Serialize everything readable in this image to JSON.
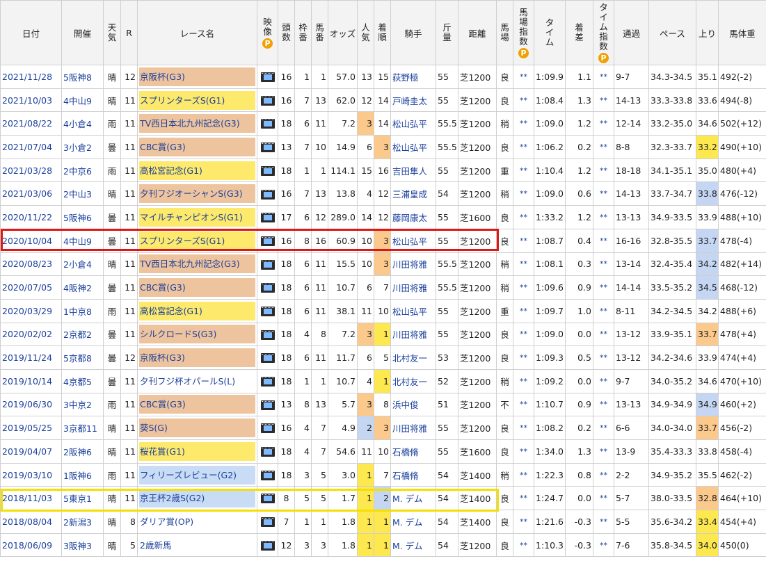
{
  "headers": {
    "date": "日付",
    "venue": "開催",
    "weather": "天気",
    "r": "R",
    "race": "レース名",
    "video": "映像",
    "p": "P",
    "heads": "頭数",
    "waku": "枠番",
    "uma": "馬番",
    "odds": "オッズ",
    "ninki": "人気",
    "chakujun": "着順",
    "jockey": "騎手",
    "kinryo": "斤量",
    "distance": "距離",
    "baba": "馬場",
    "babashisu": "馬場指数",
    "time": "タイム",
    "chakusa": "着差",
    "timeshisu": "タイム指数",
    "tsuka": "通過",
    "pace": "ペース",
    "agari": "上り",
    "bataiju": "馬体重"
  },
  "rows": [
    {
      "date": "2021/11/28",
      "venue": "5阪神8",
      "weather": "晴",
      "r": "12",
      "race": "京阪杯(G3)",
      "grade": "g3",
      "heads": "16",
      "waku": "1",
      "uma": "1",
      "odds": "57.0",
      "ninki": "13",
      "chaku": "15",
      "jockey": "荻野極",
      "kinryo": "55",
      "dist": "芝1200",
      "baba": "良",
      "bs": "**",
      "time": "1:09.9",
      "diff": "1.1",
      "ts": "**",
      "pass": "9-7",
      "pace": "34.3-34.5",
      "agari": "35.1",
      "weight": "492(-2)",
      "nk": "",
      "ck": "",
      "ak": ""
    },
    {
      "date": "2021/10/03",
      "venue": "4中山9",
      "weather": "晴",
      "r": "11",
      "race": "スプリンターズS(G1)",
      "grade": "g1",
      "heads": "16",
      "waku": "7",
      "uma": "13",
      "odds": "62.0",
      "ninki": "12",
      "chaku": "14",
      "jockey": "戸崎圭太",
      "kinryo": "55",
      "dist": "芝1200",
      "baba": "良",
      "bs": "**",
      "time": "1:08.4",
      "diff": "1.3",
      "ts": "**",
      "pass": "14-13",
      "pace": "33.3-33.8",
      "agari": "33.6",
      "weight": "494(-8)",
      "nk": "",
      "ck": "",
      "ak": ""
    },
    {
      "date": "2021/08/22",
      "venue": "4小倉4",
      "weather": "雨",
      "r": "11",
      "race": "TV西日本北九州記念(G3)",
      "grade": "g3",
      "heads": "18",
      "waku": "6",
      "uma": "11",
      "odds": "7.2",
      "ninki": "3",
      "chaku": "14",
      "jockey": "松山弘平",
      "kinryo": "55.5",
      "dist": "芝1200",
      "baba": "稍",
      "bs": "**",
      "time": "1:09.0",
      "diff": "1.2",
      "ts": "**",
      "pass": "12-14",
      "pace": "33.2-35.0",
      "agari": "34.6",
      "weight": "502(+12)",
      "nk": "hl1",
      "ck": "",
      "ak": ""
    },
    {
      "date": "2021/07/04",
      "venue": "3小倉2",
      "weather": "曇",
      "r": "11",
      "race": "CBC賞(G3)",
      "grade": "g3",
      "heads": "13",
      "waku": "7",
      "uma": "10",
      "odds": "14.9",
      "ninki": "6",
      "chaku": "3",
      "jockey": "松山弘平",
      "kinryo": "55.5",
      "dist": "芝1200",
      "baba": "良",
      "bs": "**",
      "time": "1:06.2",
      "diff": "0.2",
      "ts": "**",
      "pass": "8-8",
      "pace": "32.3-33.7",
      "agari": "33.2",
      "weight": "490(+10)",
      "nk": "",
      "ck": "hl1",
      "ak": "up1"
    },
    {
      "date": "2021/03/28",
      "venue": "2中京6",
      "weather": "雨",
      "r": "11",
      "race": "高松宮記念(G1)",
      "grade": "g1",
      "heads": "18",
      "waku": "1",
      "uma": "1",
      "odds": "114.1",
      "ninki": "15",
      "chaku": "16",
      "jockey": "吉田隼人",
      "kinryo": "55",
      "dist": "芝1200",
      "baba": "重",
      "bs": "**",
      "time": "1:10.4",
      "diff": "1.2",
      "ts": "**",
      "pass": "18-18",
      "pace": "34.1-35.1",
      "agari": "35.0",
      "weight": "480(+4)",
      "nk": "",
      "ck": "",
      "ak": ""
    },
    {
      "date": "2021/03/06",
      "venue": "2中山3",
      "weather": "晴",
      "r": "11",
      "race": "夕刊フジオーシャンS(G3)",
      "grade": "g3",
      "heads": "16",
      "waku": "7",
      "uma": "13",
      "odds": "13.8",
      "ninki": "4",
      "chaku": "12",
      "jockey": "三浦皇成",
      "kinryo": "54",
      "dist": "芝1200",
      "baba": "稍",
      "bs": "**",
      "time": "1:09.0",
      "diff": "0.6",
      "ts": "**",
      "pass": "14-13",
      "pace": "33.7-34.7",
      "agari": "33.8",
      "weight": "476(-12)",
      "nk": "",
      "ck": "",
      "ak": "up3"
    },
    {
      "date": "2020/11/22",
      "venue": "5阪神6",
      "weather": "曇",
      "r": "11",
      "race": "マイルチャンピオンS(G1)",
      "grade": "g1",
      "heads": "17",
      "waku": "6",
      "uma": "12",
      "odds": "289.0",
      "ninki": "14",
      "chaku": "12",
      "jockey": "藤岡康太",
      "kinryo": "55",
      "dist": "芝1600",
      "baba": "良",
      "bs": "**",
      "time": "1:33.2",
      "diff": "1.2",
      "ts": "**",
      "pass": "13-13",
      "pace": "34.9-33.5",
      "agari": "33.9",
      "weight": "488(+10)",
      "nk": "",
      "ck": "",
      "ak": ""
    },
    {
      "date": "2020/10/04",
      "venue": "4中山9",
      "weather": "曇",
      "r": "11",
      "race": "スプリンターズS(G1)",
      "grade": "g1",
      "heads": "16",
      "waku": "8",
      "uma": "16",
      "odds": "60.9",
      "ninki": "10",
      "chaku": "3",
      "jockey": "松山弘平",
      "kinryo": "55",
      "dist": "芝1200",
      "baba": "良",
      "bs": "**",
      "time": "1:08.7",
      "diff": "0.4",
      "ts": "**",
      "pass": "16-16",
      "pace": "32.8-35.5",
      "agari": "33.7",
      "weight": "478(-4)",
      "nk": "",
      "ck": "hl1",
      "ak": "up3"
    },
    {
      "date": "2020/08/23",
      "venue": "2小倉4",
      "weather": "晴",
      "r": "11",
      "race": "TV西日本北九州記念(G3)",
      "grade": "g3",
      "heads": "18",
      "waku": "6",
      "uma": "11",
      "odds": "15.5",
      "ninki": "10",
      "chaku": "3",
      "jockey": "川田将雅",
      "kinryo": "55.5",
      "dist": "芝1200",
      "baba": "稍",
      "bs": "**",
      "time": "1:08.1",
      "diff": "0.3",
      "ts": "**",
      "pass": "13-14",
      "pace": "32.4-35.4",
      "agari": "34.2",
      "weight": "482(+14)",
      "nk": "",
      "ck": "hl1",
      "ak": "up3"
    },
    {
      "date": "2020/07/05",
      "venue": "4阪神2",
      "weather": "曇",
      "r": "11",
      "race": "CBC賞(G3)",
      "grade": "g3",
      "heads": "18",
      "waku": "6",
      "uma": "11",
      "odds": "10.7",
      "ninki": "6",
      "chaku": "7",
      "jockey": "川田将雅",
      "kinryo": "55.5",
      "dist": "芝1200",
      "baba": "稍",
      "bs": "**",
      "time": "1:09.6",
      "diff": "0.9",
      "ts": "**",
      "pass": "14-14",
      "pace": "33.5-35.2",
      "agari": "34.5",
      "weight": "468(-12)",
      "nk": "",
      "ck": "",
      "ak": "up3"
    },
    {
      "date": "2020/03/29",
      "venue": "1中京8",
      "weather": "雨",
      "r": "11",
      "race": "高松宮記念(G1)",
      "grade": "g1",
      "heads": "18",
      "waku": "6",
      "uma": "11",
      "odds": "38.1",
      "ninki": "11",
      "chaku": "10",
      "jockey": "松山弘平",
      "kinryo": "55",
      "dist": "芝1200",
      "baba": "重",
      "bs": "**",
      "time": "1:09.7",
      "diff": "1.0",
      "ts": "**",
      "pass": "8-11",
      "pace": "34.2-34.5",
      "agari": "34.2",
      "weight": "488(+6)",
      "nk": "",
      "ck": "",
      "ak": ""
    },
    {
      "date": "2020/02/02",
      "venue": "2京都2",
      "weather": "曇",
      "r": "11",
      "race": "シルクロードS(G3)",
      "grade": "g3",
      "heads": "18",
      "waku": "4",
      "uma": "8",
      "odds": "7.2",
      "ninki": "3",
      "chaku": "1",
      "jockey": "川田将雅",
      "kinryo": "55",
      "dist": "芝1200",
      "baba": "良",
      "bs": "**",
      "time": "1:09.0",
      "diff": "0.0",
      "ts": "**",
      "pass": "13-12",
      "pace": "33.9-35.1",
      "agari": "33.7",
      "weight": "478(+4)",
      "nk": "hl1",
      "ck": "hl3",
      "ak": "up2"
    },
    {
      "date": "2019/11/24",
      "venue": "5京都8",
      "weather": "曇",
      "r": "12",
      "race": "京阪杯(G3)",
      "grade": "g3",
      "heads": "18",
      "waku": "6",
      "uma": "11",
      "odds": "11.7",
      "ninki": "6",
      "chaku": "5",
      "jockey": "北村友一",
      "kinryo": "53",
      "dist": "芝1200",
      "baba": "良",
      "bs": "**",
      "time": "1:09.3",
      "diff": "0.5",
      "ts": "**",
      "pass": "13-12",
      "pace": "34.2-34.6",
      "agari": "33.9",
      "weight": "474(+4)",
      "nk": "",
      "ck": "",
      "ak": ""
    },
    {
      "date": "2019/10/14",
      "venue": "4京都5",
      "weather": "曇",
      "r": "11",
      "race": "夕刊フジ杯オパールS(L)",
      "grade": "gn",
      "heads": "18",
      "waku": "1",
      "uma": "1",
      "odds": "10.7",
      "ninki": "4",
      "chaku": "1",
      "jockey": "北村友一",
      "kinryo": "52",
      "dist": "芝1200",
      "baba": "稍",
      "bs": "**",
      "time": "1:09.2",
      "diff": "0.0",
      "ts": "**",
      "pass": "9-7",
      "pace": "34.0-35.2",
      "agari": "34.6",
      "weight": "470(+10)",
      "nk": "",
      "ck": "hl3",
      "ak": ""
    },
    {
      "date": "2019/06/30",
      "venue": "3中京2",
      "weather": "雨",
      "r": "11",
      "race": "CBC賞(G3)",
      "grade": "g3",
      "heads": "13",
      "waku": "8",
      "uma": "13",
      "odds": "5.7",
      "ninki": "3",
      "chaku": "8",
      "jockey": "浜中俊",
      "kinryo": "51",
      "dist": "芝1200",
      "baba": "不",
      "bs": "**",
      "time": "1:10.7",
      "diff": "0.9",
      "ts": "**",
      "pass": "13-13",
      "pace": "34.9-34.9",
      "agari": "34.9",
      "weight": "460(+2)",
      "nk": "hl1",
      "ck": "",
      "ak": "up3"
    },
    {
      "date": "2019/05/25",
      "venue": "3京都11",
      "weather": "晴",
      "r": "11",
      "race": "葵S(G)",
      "grade": "g3",
      "heads": "16",
      "waku": "4",
      "uma": "7",
      "odds": "4.9",
      "ninki": "2",
      "chaku": "3",
      "jockey": "川田将雅",
      "kinryo": "55",
      "dist": "芝1200",
      "baba": "良",
      "bs": "**",
      "time": "1:08.2",
      "diff": "0.2",
      "ts": "**",
      "pass": "6-6",
      "pace": "34.0-34.0",
      "agari": "33.7",
      "weight": "456(-2)",
      "nk": "hl2",
      "ck": "hl1",
      "ak": "up2"
    },
    {
      "date": "2019/04/07",
      "venue": "2阪神6",
      "weather": "晴",
      "r": "11",
      "race": "桜花賞(G1)",
      "grade": "g1",
      "heads": "18",
      "waku": "4",
      "uma": "7",
      "odds": "54.6",
      "ninki": "11",
      "chaku": "10",
      "jockey": "石橋脩",
      "kinryo": "55",
      "dist": "芝1600",
      "baba": "良",
      "bs": "**",
      "time": "1:34.0",
      "diff": "1.3",
      "ts": "**",
      "pass": "13-9",
      "pace": "35.4-33.3",
      "agari": "33.8",
      "weight": "458(-4)",
      "nk": "",
      "ck": "",
      "ak": ""
    },
    {
      "date": "2019/03/10",
      "venue": "1阪神6",
      "weather": "雨",
      "r": "11",
      "race": "フィリーズレビュー(G2)",
      "grade": "g2",
      "heads": "18",
      "waku": "3",
      "uma": "5",
      "odds": "3.0",
      "ninki": "1",
      "chaku": "7",
      "jockey": "石橋脩",
      "kinryo": "54",
      "dist": "芝1400",
      "baba": "稍",
      "bs": "**",
      "time": "1:22.3",
      "diff": "0.8",
      "ts": "**",
      "pass": "2-2",
      "pace": "34.9-35.2",
      "agari": "35.5",
      "weight": "462(-2)",
      "nk": "hl3",
      "ck": "",
      "ak": ""
    },
    {
      "date": "2018/11/03",
      "venue": "5東京1",
      "weather": "晴",
      "r": "11",
      "race": "京王杯2歳S(G2)",
      "grade": "g2",
      "heads": "8",
      "waku": "5",
      "uma": "5",
      "odds": "1.7",
      "ninki": "1",
      "chaku": "2",
      "jockey": "M. デム",
      "kinryo": "54",
      "dist": "芝1400",
      "baba": "良",
      "bs": "**",
      "time": "1:24.7",
      "diff": "0.0",
      "ts": "**",
      "pass": "5-7",
      "pace": "38.0-33.5",
      "agari": "32.8",
      "weight": "464(+10)",
      "nk": "hl3",
      "ck": "hl2",
      "ak": "up2"
    },
    {
      "date": "2018/08/04",
      "venue": "2新潟3",
      "weather": "晴",
      "r": "8",
      "race": "ダリア賞(OP)",
      "grade": "gn",
      "heads": "7",
      "waku": "1",
      "uma": "1",
      "odds": "1.8",
      "ninki": "1",
      "chaku": "1",
      "jockey": "M. デム",
      "kinryo": "54",
      "dist": "芝1400",
      "baba": "良",
      "bs": "**",
      "time": "1:21.6",
      "diff": "-0.3",
      "ts": "**",
      "pass": "5-5",
      "pace": "35.6-34.2",
      "agari": "33.4",
      "weight": "454(+4)",
      "nk": "hl3",
      "ck": "hl3",
      "ak": "up1"
    },
    {
      "date": "2018/06/09",
      "venue": "3阪神3",
      "weather": "晴",
      "r": "5",
      "race": "2歳新馬",
      "grade": "gn",
      "heads": "12",
      "waku": "3",
      "uma": "3",
      "odds": "1.8",
      "ninki": "1",
      "chaku": "1",
      "jockey": "M. デム",
      "kinryo": "54",
      "dist": "芝1200",
      "baba": "良",
      "bs": "**",
      "time": "1:10.3",
      "diff": "-0.3",
      "ts": "**",
      "pass": "7-6",
      "pace": "35.8-34.5",
      "agari": "34.0",
      "weight": "450(0)",
      "nk": "hl3",
      "ck": "hl3",
      "ak": "up1"
    }
  ]
}
